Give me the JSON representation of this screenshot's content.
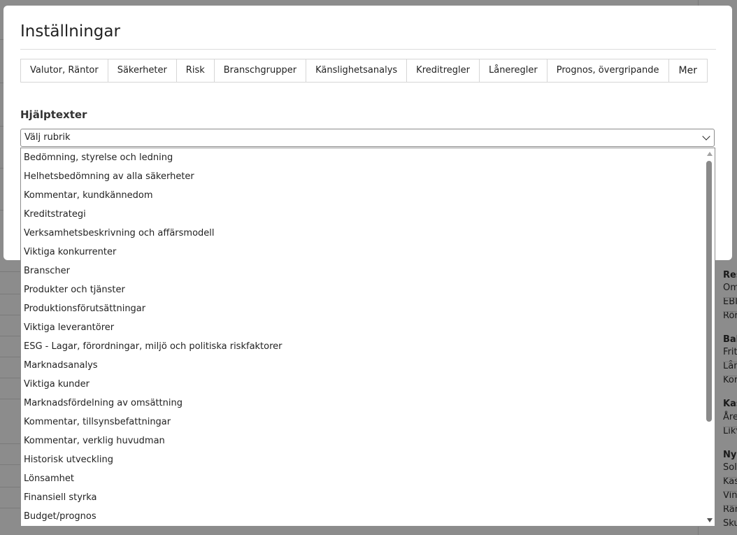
{
  "modal": {
    "title": "Inställningar",
    "tabs": [
      {
        "label": "Valutor, Räntor"
      },
      {
        "label": "Säkerheter"
      },
      {
        "label": "Risk"
      },
      {
        "label": "Branschgrupper"
      },
      {
        "label": "Känslighetsanalys"
      },
      {
        "label": "Kreditregler"
      },
      {
        "label": "Låneregler"
      },
      {
        "label": "Prognos, övergripande"
      },
      {
        "label": "Mer"
      }
    ],
    "section_heading": "Hjälptexter",
    "select": {
      "value": "Välj rubrik",
      "options": [
        "Bedömning, styrelse och ledning",
        "Helhetsbedömning av alla säkerheter",
        "Kommentar, kundkännedom",
        "Kreditstrategi",
        "Verksamhetsbeskrivning och affärsmodell",
        "Viktiga konkurrenter",
        "Branscher",
        "Produkter och tjänster",
        "Produktionsförutsättningar",
        "Viktiga leverantörer",
        "ESG - Lagar, förordningar, miljö och politiska riskfaktorer",
        "Marknadsanalys",
        "Viktiga kunder",
        "Marknadsfördelning av omsättning",
        "Kommentar, tillsynsbefattningar",
        "Kommentar, verklig huvudman",
        "Historisk utveckling",
        "Lönsamhet",
        "Finansiell styrka",
        "Budget/prognos"
      ]
    }
  },
  "background": {
    "right_col_fragments": [
      {
        "text": "Res",
        "bold": true
      },
      {
        "text": "Om",
        "bold": false
      },
      {
        "text": "EBI",
        "bold": false
      },
      {
        "text": "Rör",
        "bold": false
      },
      {
        "text": "Bal",
        "bold": true
      },
      {
        "text": "Frit",
        "bold": false
      },
      {
        "text": "Lån",
        "bold": false
      },
      {
        "text": "Kor",
        "bold": false
      },
      {
        "text": "Kas",
        "bold": true
      },
      {
        "text": "Åre",
        "bold": false
      },
      {
        "text": "Likv",
        "bold": false
      },
      {
        "text": "Nyc",
        "bold": true
      },
      {
        "text": "Sol",
        "bold": false
      },
      {
        "text": "Kas",
        "bold": false
      },
      {
        "text": "Vin",
        "bold": false
      },
      {
        "text": "Rän",
        "bold": false
      },
      {
        "text": "Sku",
        "bold": false
      }
    ]
  },
  "colors": {
    "overlay": "#8c8c8c",
    "modal_bg": "#ffffff",
    "scroll_thumb": "#8a8a8a"
  }
}
